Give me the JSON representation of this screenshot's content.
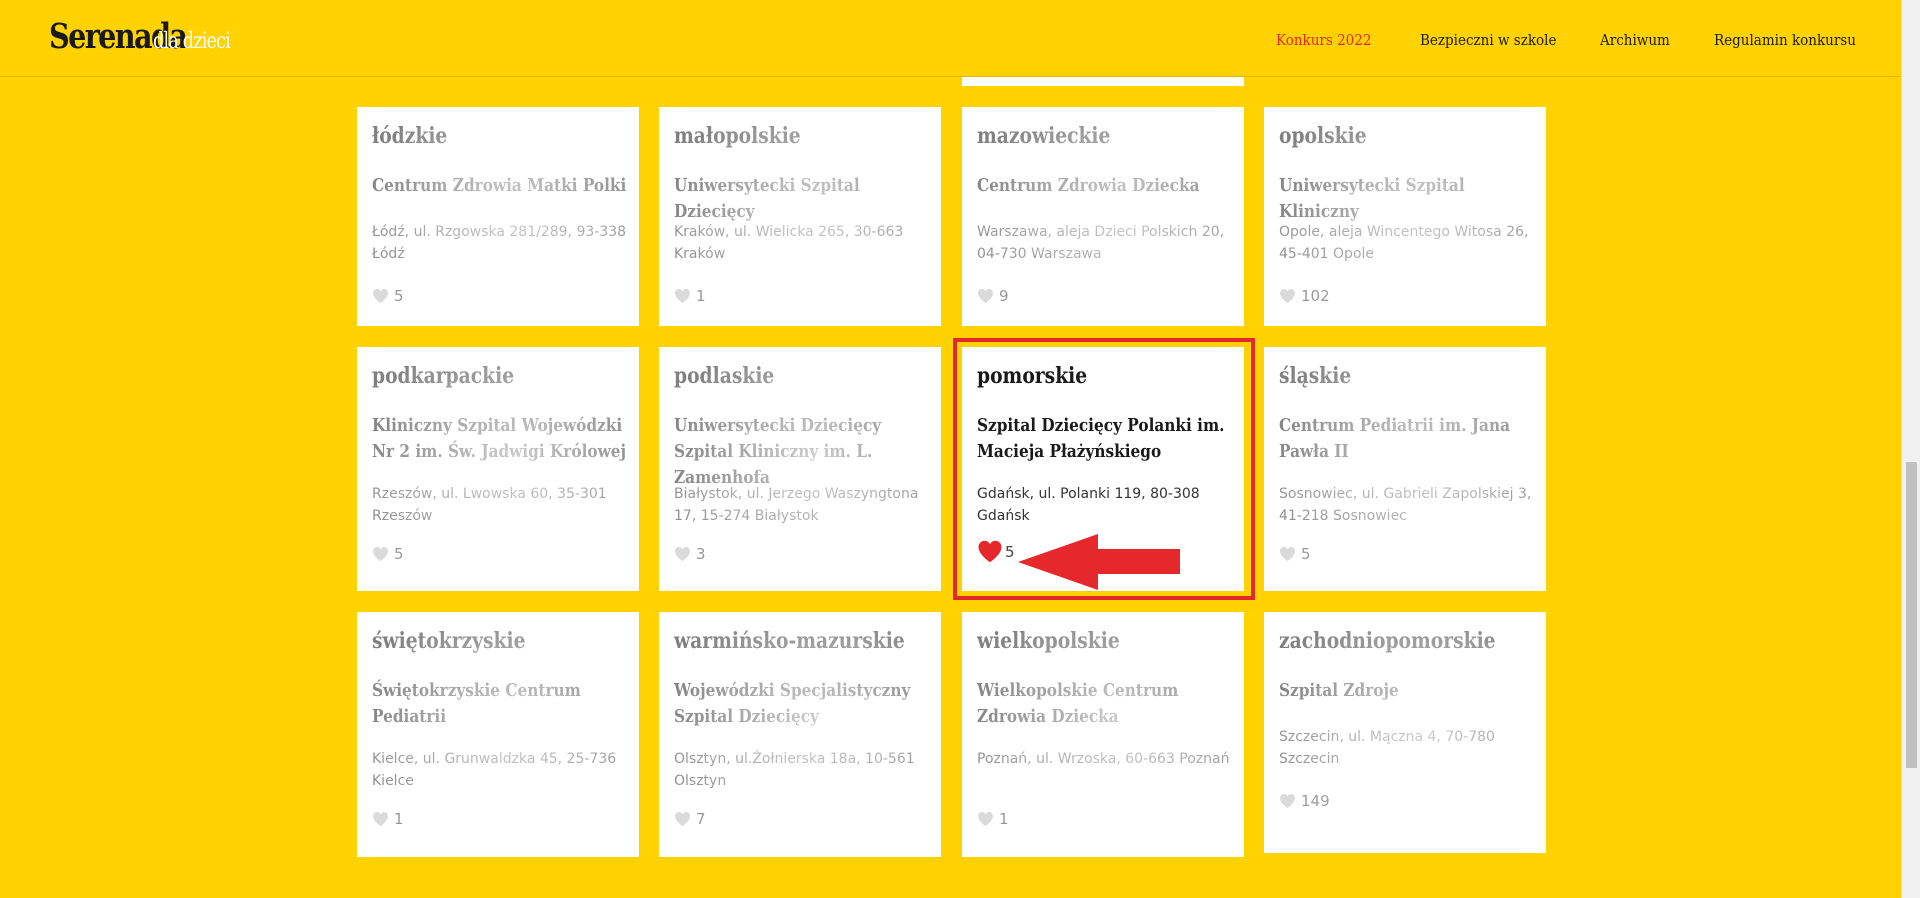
{
  "header": {
    "logo_main": "Serenada",
    "logo_sub": "dla dzieci",
    "nav": [
      {
        "label": "Konkurs 2022",
        "active": true
      },
      {
        "label": "Bezpieczni w szkole",
        "active": false
      },
      {
        "label": "Archiwum",
        "active": false
      },
      {
        "label": "Regulamin konkursu",
        "active": false
      }
    ]
  },
  "colors": {
    "background": "#ffd200",
    "accent": "#e4282c",
    "heart_inactive": "#bdbdbd",
    "heart_active": "#e4282c"
  },
  "cards": [
    {
      "region": "łódzkie",
      "name": "Centrum Zdrowia Matki Polki",
      "address": "Łódź, ul. Rzgowska 281/289, 93-338 Łódź",
      "likes": "5",
      "liked": false,
      "faded": true
    },
    {
      "region": "małopolskie",
      "name": "Uniwersytecki Szpital Dziecięcy",
      "address": "Kraków, ul. Wielicka 265, 30-663 Kraków",
      "likes": "1",
      "liked": false,
      "faded": true
    },
    {
      "region": "mazowieckie",
      "name": "Centrum Zdrowia Dziecka",
      "address": "Warszawa, aleja Dzieci Polskich 20, 04-730 Warszawa",
      "likes": "9",
      "liked": false,
      "faded": true
    },
    {
      "region": "opolskie",
      "name": "Uniwersytecki Szpital Kliniczny",
      "address": "Opole, aleja Wincentego Witosa 26, 45-401 Opole",
      "likes": "102",
      "liked": false,
      "faded": true
    },
    {
      "region": "podkarpackie",
      "name": "Kliniczny Szpital Wojewódzki Nr 2 im. Św. Jadwigi Królowej",
      "address": "Rzeszów, ul. Lwowska 60, 35-301 Rzeszów",
      "likes": "5",
      "liked": false,
      "faded": true
    },
    {
      "region": "podlaskie",
      "name": "Uniwersytecki Dziecięcy Szpital Kliniczny im. L. Zamenhofa",
      "address": "Białystok, ul. Jerzego Waszyngtona 17, 15-274 Białystok",
      "likes": "3",
      "liked": false,
      "faded": true
    },
    {
      "region": "pomorskie",
      "name": "Szpital Dziecięcy Polanki im. Macieja Płażyńskiego",
      "address": "Gdańsk, ul. Polanki 119, 80-308 Gdańsk",
      "likes": "5",
      "liked": true,
      "faded": false
    },
    {
      "region": "śląskie",
      "name": "Centrum Pediatrii im. Jana Pawła II",
      "address": "Sosnowiec, ul. Gabrieli Zapolskiej 3, 41-218 Sosnowiec",
      "likes": "5",
      "liked": false,
      "faded": true
    },
    {
      "region": "świętokrzyskie",
      "name": "Świętokrzyskie Centrum Pediatrii",
      "address": "Kielce, ul. Grunwaldzka 45, 25-736 Kielce",
      "likes": "1",
      "liked": false,
      "faded": true
    },
    {
      "region": "warmińsko-mazurskie",
      "name": "Wojewódzki Specjalistyczny Szpital Dziecięcy",
      "address": "Olsztyn, ul.Żołnierska 18a, 10-561 Olsztyn",
      "likes": "7",
      "liked": false,
      "faded": true
    },
    {
      "region": "wielkopolskie",
      "name": "Wielkopolskie Centrum Zdrowia Dziecka",
      "address": "Poznań, ul. Wrzoska, 60-663 Poznań",
      "likes": "1",
      "liked": false,
      "faded": true
    },
    {
      "region": "zachodniopomorskie",
      "name": "Szpital Zdroje",
      "address": "Szczecin, ul. Mączna 4, 70-780 Szczecin",
      "likes": "149",
      "liked": false,
      "faded": true
    }
  ]
}
